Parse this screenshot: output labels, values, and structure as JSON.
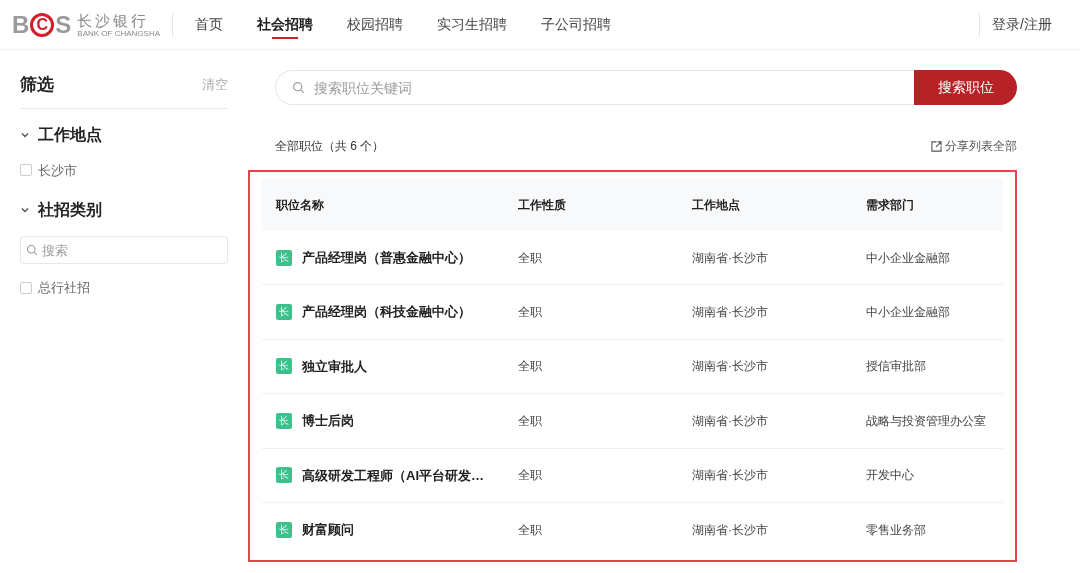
{
  "header": {
    "logo": {
      "letters_1": "B",
      "letters_2": "C",
      "letters_3": "S",
      "name": "长沙银行",
      "english": "BANK OF CHANGSHA"
    },
    "nav": [
      {
        "label": "首页",
        "selected": false
      },
      {
        "label": "社会招聘",
        "selected": true
      },
      {
        "label": "校园招聘",
        "selected": false
      },
      {
        "label": "实习生招聘",
        "selected": false
      },
      {
        "label": "子公司招聘",
        "selected": false
      }
    ],
    "login": "登录/注册"
  },
  "sidebar": {
    "title": "筛选",
    "clear": "清空",
    "groups": [
      {
        "title": "工作地点",
        "expanded": true,
        "options": [
          {
            "label": "长沙市",
            "checked": false
          }
        ]
      },
      {
        "title": "社招类别",
        "expanded": true,
        "search_placeholder": "搜索",
        "options": [
          {
            "label": "总行社招",
            "checked": false
          }
        ]
      }
    ]
  },
  "search": {
    "placeholder": "搜索职位关键词",
    "button": "搜索职位"
  },
  "summary": "全部职位（共 6 个）",
  "share": "分享列表全部",
  "table": {
    "highlighted": true,
    "columns": [
      "职位名称",
      "工作性质",
      "工作地点",
      "需求部门"
    ],
    "rows": [
      {
        "tag": "长",
        "title": "产品经理岗（普惠金融中心）",
        "type": "全职",
        "location": "湖南省·长沙市",
        "department": "中小企业金融部"
      },
      {
        "tag": "长",
        "title": "产品经理岗（科技金融中心）",
        "type": "全职",
        "location": "湖南省·长沙市",
        "department": "中小企业金融部"
      },
      {
        "tag": "长",
        "title": "独立审批人",
        "type": "全职",
        "location": "湖南省·长沙市",
        "department": "授信审批部"
      },
      {
        "tag": "长",
        "title": "博士后岗",
        "type": "全职",
        "location": "湖南省·长沙市",
        "department": "战略与投资管理办公室"
      },
      {
        "tag": "长",
        "title": "高级研发工程师（AI平台研发…",
        "type": "全职",
        "location": "湖南省·长沙市",
        "department": "开发中心"
      },
      {
        "tag": "长",
        "title": "财富顾问",
        "type": "全职",
        "location": "湖南省·长沙市",
        "department": "零售业务部"
      }
    ]
  }
}
